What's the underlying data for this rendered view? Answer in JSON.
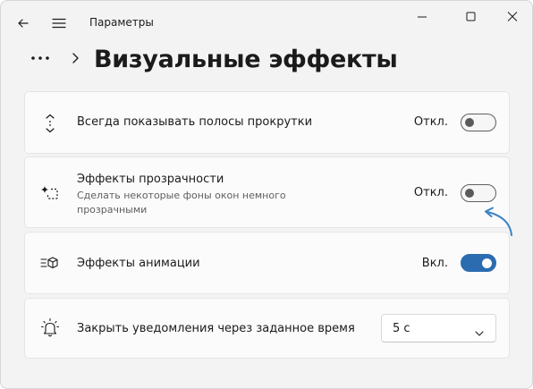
{
  "window": {
    "title": "Параметры"
  },
  "header": {
    "title": "Визуальные эффекты"
  },
  "settings": [
    {
      "id": "scrollbars",
      "icon": "scroll-arrows-icon",
      "title": "Всегда показывать полосы прокрутки",
      "state_label": "Откл.",
      "enabled": false
    },
    {
      "id": "transparency",
      "icon": "transparency-sparkle-icon",
      "title": "Эффекты прозрачности",
      "description": "Сделать некоторые фоны окон немного прозрачными",
      "state_label": "Откл.",
      "enabled": false
    },
    {
      "id": "animation",
      "icon": "animation-icon",
      "title": "Эффекты анимации",
      "state_label": "Вкл.",
      "enabled": true
    },
    {
      "id": "notifications",
      "icon": "bell-icon",
      "title": "Закрыть уведомления через заданное время",
      "dropdown_value": "5 с"
    }
  ],
  "colors": {
    "accent": "#2b6cb0",
    "annotation_arrow": "#3b82c4",
    "background": "#f3f3f3",
    "card": "#fbfbfb"
  }
}
